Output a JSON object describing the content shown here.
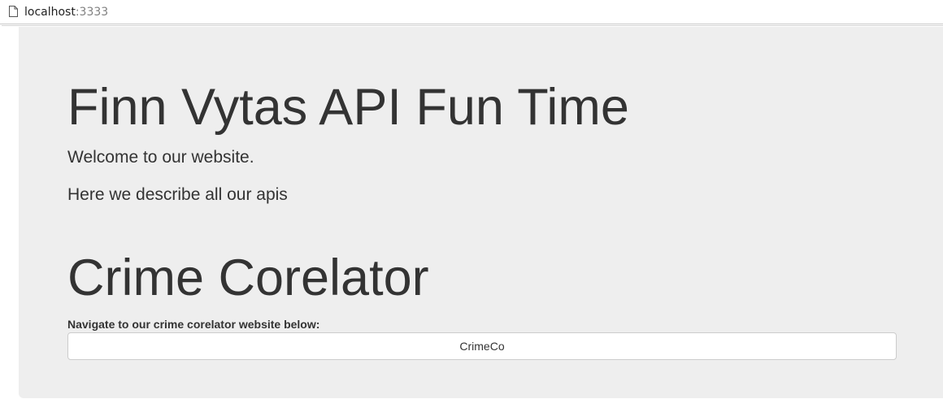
{
  "browser": {
    "url_host": "localhost",
    "url_port": ":3333",
    "page_icon": "page-icon"
  },
  "jumbotron": {
    "title": "Finn Vytas API Fun Time",
    "lead_1": "Welcome to our website.",
    "lead_2": "Here we describe all our apis",
    "background_color": "#eeeeee"
  },
  "crime_section": {
    "title": "Crime Corelator",
    "navigate_label": "Navigate to our crime corelator website below:",
    "button_label": "CrimeCo"
  }
}
